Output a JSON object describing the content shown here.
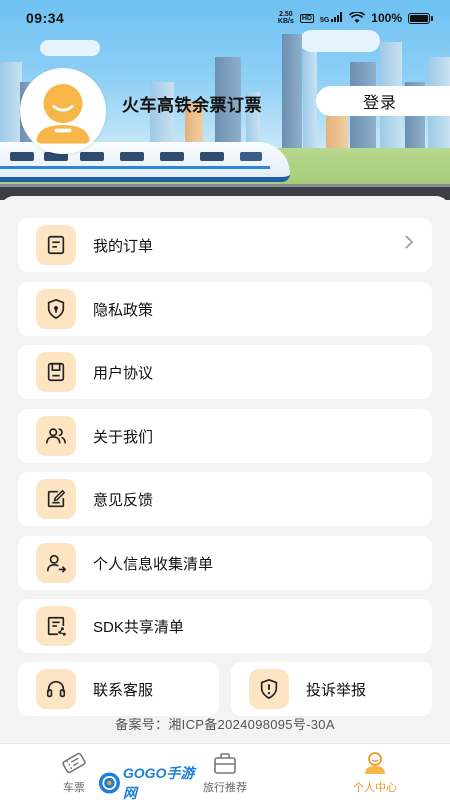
{
  "status_bar": {
    "time": "09:34",
    "net_speed_top": "2.50",
    "net_speed_bottom": "KB/s",
    "hd_label": "HD",
    "signal_label": "5G",
    "battery_pct": "100%"
  },
  "header": {
    "app_title": "火车高铁余票订票",
    "login_label": "登录"
  },
  "menu": {
    "my_orders": "我的订单",
    "privacy_policy": "隐私政策",
    "user_agreement": "用户协议",
    "about_us": "关于我们",
    "feedback": "意见反馈",
    "personal_info_list": "个人信息收集清单",
    "sdk_share_list": "SDK共享清单",
    "contact_service": "联系客服",
    "complaint_report": "投诉举报"
  },
  "footer": {
    "icp": "备案号：湘ICP备2024098095号-30A"
  },
  "tabbar": {
    "tickets": "车票",
    "travel_recommend": "旅行推荐",
    "personal_center": "个人中心",
    "watermark_text": "GOGO手游网"
  },
  "colors": {
    "accent": "#e59a2a",
    "icon_bg": "#fde4c2"
  }
}
